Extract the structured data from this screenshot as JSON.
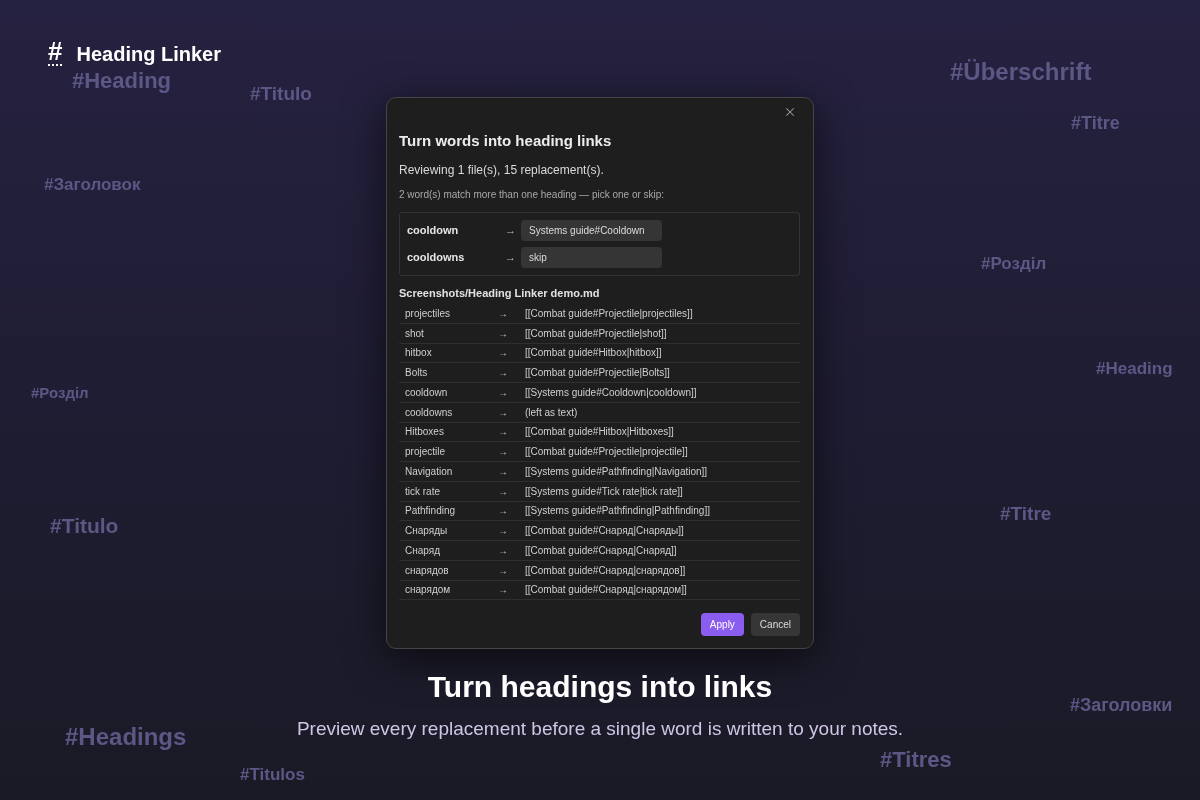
{
  "background_tags": [
    {
      "text": "#Heading"
    },
    {
      "text": "#Titulo"
    },
    {
      "text": "#Заголовок"
    },
    {
      "text": "#Überschrift"
    },
    {
      "text": "#Titre"
    },
    {
      "text": "#Розділ"
    },
    {
      "text": "#Heading"
    },
    {
      "text": "#Розділ"
    },
    {
      "text": "#Titulo"
    },
    {
      "text": "#Titre"
    },
    {
      "text": "#Заголовки"
    },
    {
      "text": "#Headings"
    },
    {
      "text": "#Titres"
    },
    {
      "text": "#Titulos"
    }
  ],
  "brand": {
    "mark": "#",
    "name": "Heading Linker"
  },
  "dialog": {
    "title": "Turn words into heading links",
    "summary": "Reviewing 1 file(s), 15 replacement(s).",
    "prompt": "2 word(s) match more than one heading — pick one or skip:",
    "choices": [
      {
        "word": "cooldown",
        "arrow": "→",
        "value": "Systems guide#Cooldown"
      },
      {
        "word": "cooldowns",
        "arrow": "→",
        "value": "skip"
      }
    ],
    "file": "Screenshots/Heading Linker demo.md",
    "replacements": [
      {
        "word": "projectiles",
        "arrow": "→",
        "result": "[[Combat guide#Projectile|projectiles]]"
      },
      {
        "word": "shot",
        "arrow": "→",
        "result": "[[Combat guide#Projectile|shot]]"
      },
      {
        "word": "hitbox",
        "arrow": "→",
        "result": "[[Combat guide#Hitbox|hitbox]]"
      },
      {
        "word": "Bolts",
        "arrow": "→",
        "result": "[[Combat guide#Projectile|Bolts]]"
      },
      {
        "word": "cooldown",
        "arrow": "→",
        "result": "[[Systems guide#Cooldown|cooldown]]"
      },
      {
        "word": "cooldowns",
        "arrow": "→",
        "result": "(left as text)"
      },
      {
        "word": "Hitboxes",
        "arrow": "→",
        "result": "[[Combat guide#Hitbox|Hitboxes]]"
      },
      {
        "word": "projectile",
        "arrow": "→",
        "result": "[[Combat guide#Projectile|projectile]]"
      },
      {
        "word": "Navigation",
        "arrow": "→",
        "result": "[[Systems guide#Pathfinding|Navigation]]"
      },
      {
        "word": "tick rate",
        "arrow": "→",
        "result": "[[Systems guide#Tick rate|tick rate]]"
      },
      {
        "word": "Pathfinding",
        "arrow": "→",
        "result": "[[Systems guide#Pathfinding|Pathfinding]]"
      },
      {
        "word": "Снаряды",
        "arrow": "→",
        "result": "[[Combat guide#Снаряд|Снаряды]]"
      },
      {
        "word": "Снаряд",
        "arrow": "→",
        "result": "[[Combat guide#Снаряд|Снаряд]]"
      },
      {
        "word": "снарядов",
        "arrow": "→",
        "result": "[[Combat guide#Снаряд|снарядов]]"
      },
      {
        "word": "снарядом",
        "arrow": "→",
        "result": "[[Combat guide#Снаряд|снарядом]]"
      }
    ],
    "buttons": [
      {
        "label": "Apply",
        "kind": "primary"
      },
      {
        "label": "Cancel",
        "kind": "secondary"
      }
    ]
  },
  "hero": {
    "title": "Turn headings into links",
    "subtitle": "Preview every replacement before a single word is written to your notes."
  }
}
